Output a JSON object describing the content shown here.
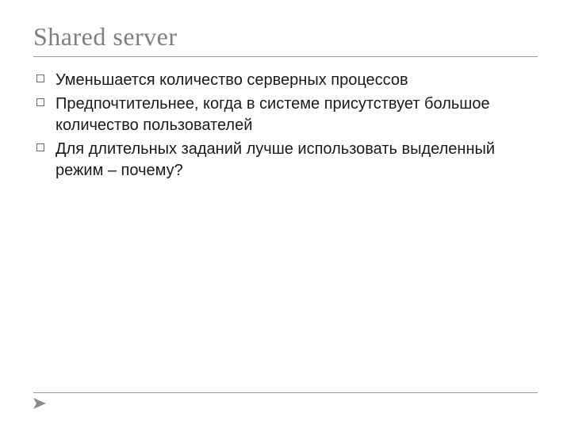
{
  "title": "Shared server",
  "bullets": [
    "Уменьшается количество серверных процессов",
    "Предпочтительнее, когда в системе присутствует большое количество пользователей",
    "Для длительных заданий лучше использовать выделенный режим – почему?"
  ]
}
